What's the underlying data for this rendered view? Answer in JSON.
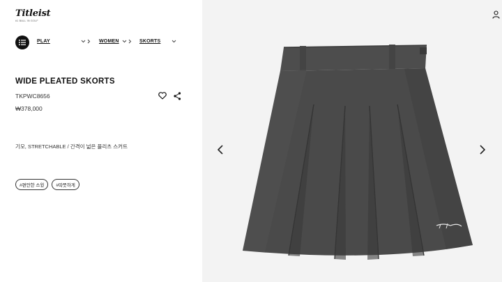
{
  "brand": {
    "logo_text": "Titleist",
    "logo_tagline": "#1 BALL IN GOLF"
  },
  "nav": {
    "menu_icon": "list-icon",
    "breadcrumbs": [
      {
        "label": "PLAY"
      },
      {
        "label": "WOMEN"
      },
      {
        "label": "SKORTS"
      }
    ],
    "chevron": "chevron-down-icon"
  },
  "product": {
    "title": "WIDE PLEATED SKORTS",
    "code": "TKPWC8656",
    "price": "₩378,000",
    "description": "기모, STRETCHABLE / 간격이 넓은 플리츠 스커트",
    "tags": [
      "#편안한 스윙",
      "#따뜻하게"
    ],
    "wishlist_icon": "heart-icon",
    "share_icon": "share-icon"
  },
  "gallery": {
    "prev_icon": "chevron-left-icon",
    "next_icon": "chevron-right-icon",
    "background": "#f3f3f3",
    "skirt_color": "#4a4a4a"
  },
  "header": {
    "user_icon": "user-icon"
  }
}
